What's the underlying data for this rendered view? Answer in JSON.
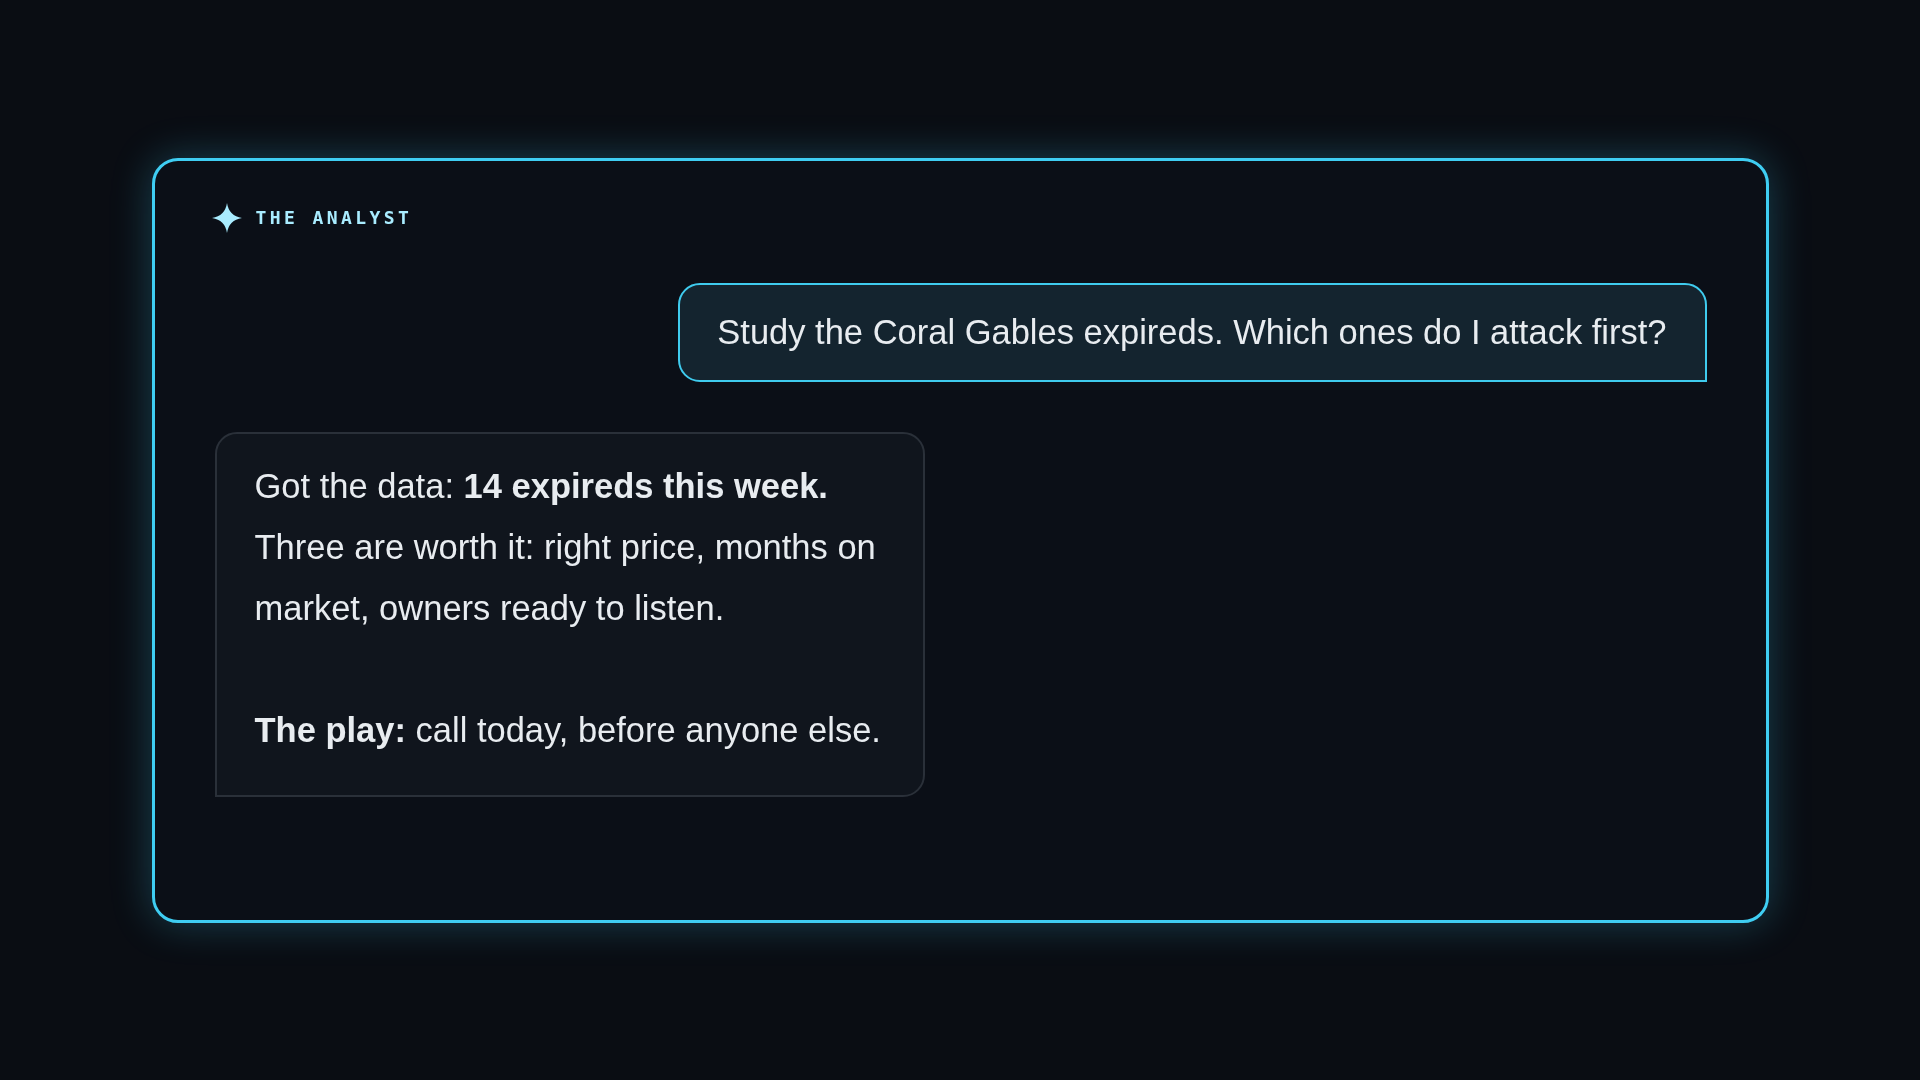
{
  "header": {
    "title": "THE ANALYST"
  },
  "messages": [
    {
      "kind": "user",
      "paragraphs": [
        "Study the Coral Gables expireds. Which ones do I attack first?"
      ]
    },
    {
      "kind": "assistant",
      "paragraphs": [
        "Got the data: **14 expireds this week.** Three are worth it: right price, months on market, owners ready to listen.",
        "**The play:** call today, before anyone else."
      ]
    }
  ]
}
